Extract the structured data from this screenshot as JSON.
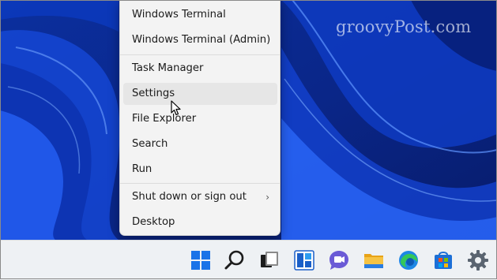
{
  "watermark": "groovyPost.com",
  "context_menu": {
    "items": [
      {
        "label": "Windows Terminal"
      },
      {
        "label": "Windows Terminal (Admin)"
      },
      {
        "label": "Task Manager"
      },
      {
        "label": "Settings",
        "hovered": true
      },
      {
        "label": "File Explorer"
      },
      {
        "label": "Search"
      },
      {
        "label": "Run"
      },
      {
        "label": "Shut down or sign out",
        "submenu": true
      },
      {
        "label": "Desktop"
      }
    ],
    "submenu_glyph": "›"
  },
  "taskbar": {
    "icons": [
      "windows-start-icon",
      "search-icon",
      "task-view-icon",
      "widgets-icon",
      "teams-chat-icon",
      "file-explorer-icon",
      "edge-browser-icon",
      "microsoft-store-icon",
      "settings-gear-icon"
    ]
  },
  "colors": {
    "menu_bg": "#f3f3f3",
    "hover_bg": "#e6e6e6",
    "wallpaper": "#0a2a8a",
    "taskbar_bg": "#eef1f4"
  }
}
